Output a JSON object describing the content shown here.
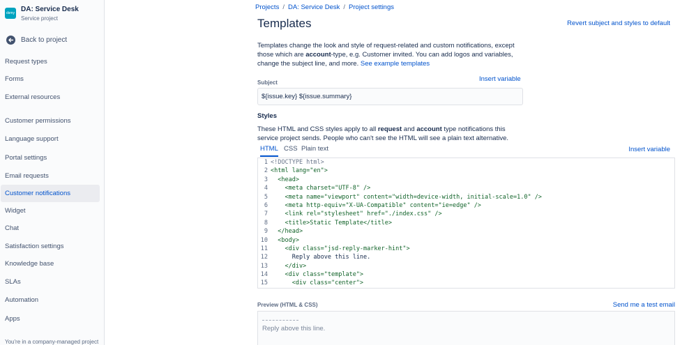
{
  "project": {
    "logo_text": "dsmy",
    "name": "DA: Service Desk",
    "type": "Service project",
    "accent": "#00a3bf"
  },
  "sidebar": {
    "back_label": "Back to project",
    "items": [
      {
        "label": "Request types",
        "active": false
      },
      {
        "label": "Forms",
        "active": false
      },
      {
        "label": "External resources",
        "active": false
      },
      {
        "label": "Customer permissions",
        "active": false
      },
      {
        "label": "Language support",
        "active": false
      },
      {
        "label": "Portal settings",
        "active": false
      },
      {
        "label": "Email requests",
        "active": false
      },
      {
        "label": "Customer notifications",
        "active": true
      },
      {
        "label": "Widget",
        "active": false
      },
      {
        "label": "Chat",
        "active": false
      },
      {
        "label": "Satisfaction settings",
        "active": false
      },
      {
        "label": "Knowledge base",
        "active": false
      },
      {
        "label": "SLAs",
        "active": false
      },
      {
        "label": "Automation",
        "active": false
      },
      {
        "label": "Apps",
        "active": false
      }
    ],
    "footer": "You're in a company-managed project"
  },
  "breadcrumb": [
    "Projects",
    "DA: Service Desk",
    "Project settings"
  ],
  "page": {
    "title": "Templates",
    "revert_label": "Revert subject and styles to default",
    "intro_1": "Templates change the look and style of request-related and custom notifications, except those which are ",
    "intro_bold": "account",
    "intro_2": "-type, e.g. Customer invited. You can add logos and variables, change the subject line, and more. ",
    "intro_link": "See example templates"
  },
  "subject": {
    "label": "Subject",
    "insert_variable": "Insert variable",
    "value": "${issue.key} ${issue.summary}"
  },
  "styles": {
    "heading": "Styles",
    "desc_1": "These HTML and CSS styles apply to all ",
    "desc_b1": "request",
    "desc_2": " and ",
    "desc_b2": "account",
    "desc_3": " type notifications this service project sends. People who can't see the HTML will see a plain text alternative.",
    "tabs": [
      {
        "label": "HTML",
        "active": true
      },
      {
        "label": "CSS",
        "active": false
      },
      {
        "label": "Plain text",
        "active": false
      }
    ],
    "insert_variable": "Insert variable"
  },
  "code_lines": [
    "<!DOCTYPE html>",
    "<html lang=\"en\">",
    "  <head>",
    "    <meta charset=\"UTF-8\" />",
    "    <meta name=\"viewport\" content=\"width=device-width, initial-scale=1.0\" />",
    "    <meta http-equiv=\"X-UA-Compatible\" content=\"ie=edge\" />",
    "    <link rel=\"stylesheet\" href=\"./index.css\" />",
    "    <title>Static Template</title>",
    "  </head>",
    "  <body>",
    "    <div class=\"jsd-reply-marker-hint\">",
    "      Reply above this line.",
    "    </div>",
    "    <div class=\"template\">",
    "      <div class=\"center\">"
  ],
  "preview": {
    "label": "Preview (HTML & CSS)",
    "send_test": "Send me a test email",
    "reply_text": "Reply above this line."
  }
}
